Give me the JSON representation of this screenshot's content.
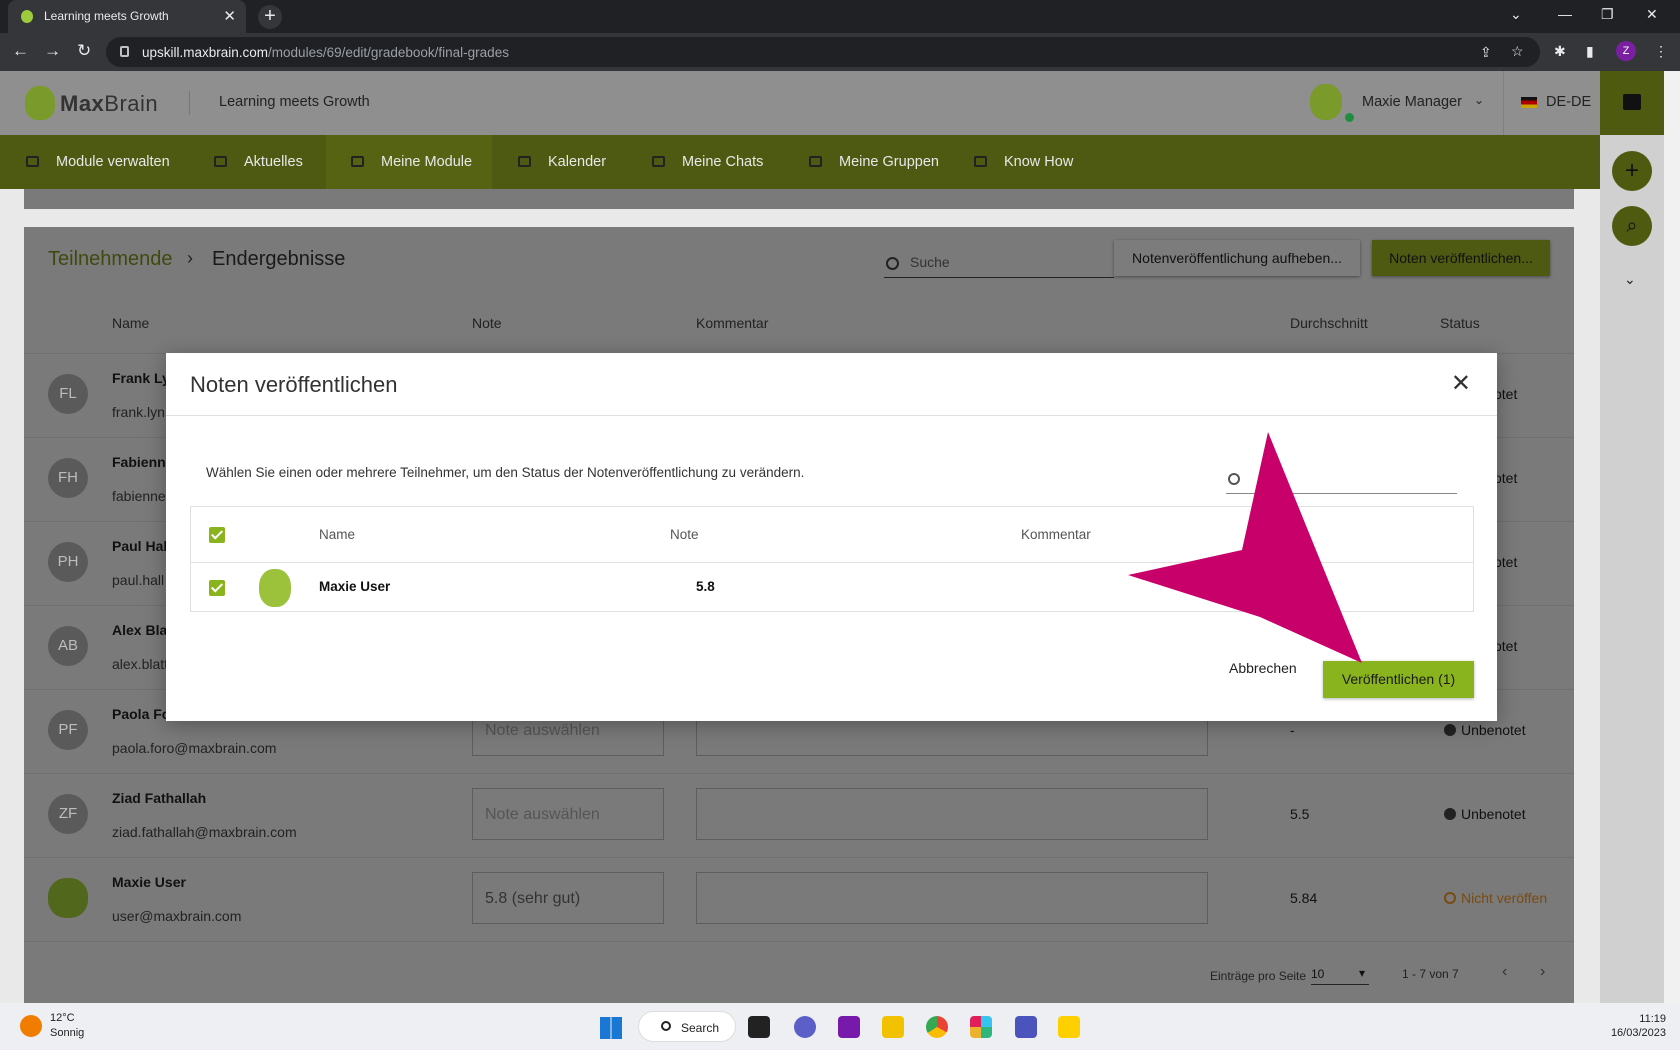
{
  "browser": {
    "tab_title": "Learning meets Growth",
    "url_host": "upskill.maxbrain.com",
    "url_path": "/modules/69/edit/gradebook/final-grades",
    "profile_initial": "Z"
  },
  "header": {
    "brand_bold": "Max",
    "brand_rest": "Brain",
    "tagline": "Learning meets Growth",
    "user_name": "Maxie Manager",
    "lang": "DE-DE"
  },
  "nav": [
    {
      "label": "Module verwalten"
    },
    {
      "label": "Aktuelles"
    },
    {
      "label": "Meine Module"
    },
    {
      "label": "Kalender"
    },
    {
      "label": "Meine Chats"
    },
    {
      "label": "Meine Gruppen"
    },
    {
      "label": "Know How"
    }
  ],
  "page": {
    "crumb_parent": "Teilnehmende",
    "crumb_current": "Endergebnisse",
    "search_placeholder": "Suche",
    "unpublish_label": "Notenveröffentlichung aufheben...",
    "publish_label": "Noten veröffentlichen...",
    "columns": {
      "name": "Name",
      "note": "Note",
      "comment": "Kommentar",
      "avg": "Durchschnitt",
      "status": "Status"
    },
    "rows": [
      {
        "initials": "FL",
        "name": "Frank Lyn",
        "email": "frank.lyn",
        "note": "",
        "avg": "",
        "status": "otet"
      },
      {
        "initials": "FH",
        "name": "Fabienne",
        "email": "fabienne",
        "note": "",
        "avg": "",
        "status": "otet"
      },
      {
        "initials": "PH",
        "name": "Paul Hall",
        "email": "paul.hall",
        "note": "",
        "avg": "",
        "status": "otet"
      },
      {
        "initials": "AB",
        "name": "Alex Blat",
        "email": "alex.blatt",
        "note": "",
        "avg": "",
        "status": "otet"
      },
      {
        "initials": "PF",
        "name": "Paola Fo",
        "email": "paola.foro@maxbrain.com",
        "note": "Note auswählen",
        "avg": "-",
        "status": "Unbenotet"
      },
      {
        "initials": "ZF",
        "name": "Ziad Fathallah",
        "email": "ziad.fathallah@maxbrain.com",
        "note": "Note auswählen",
        "avg": "5.5",
        "status": "Unbenotet"
      },
      {
        "initials": "",
        "name": "Maxie User",
        "email": "user@maxbrain.com",
        "note": "5.8 (sehr gut)",
        "avg": "5.84",
        "status": "Nicht veröffen"
      }
    ],
    "pager": {
      "per_page_label": "Einträge pro Seite",
      "per_page": "10",
      "range": "1 - 7 von 7"
    }
  },
  "modal": {
    "title": "Noten veröffentlichen",
    "description": "Wählen Sie einen oder mehrere Teilnehmer, um den Status der Notenveröffentlichung zu verändern.",
    "columns": {
      "name": "Name",
      "note": "Note",
      "comment": "Kommentar"
    },
    "row": {
      "name": "Maxie User",
      "note": "5.8"
    },
    "cancel_label": "Abbrechen",
    "confirm_label": "Veröffentlichen (1)"
  },
  "taskbar": {
    "temp": "12°C",
    "weather": "Sonnig",
    "search_label": "Search",
    "time": "11:19",
    "date": "16/03/2023"
  },
  "colors": {
    "brand_green": "#8ab41e",
    "annotation_arrow": "#c8006a"
  }
}
